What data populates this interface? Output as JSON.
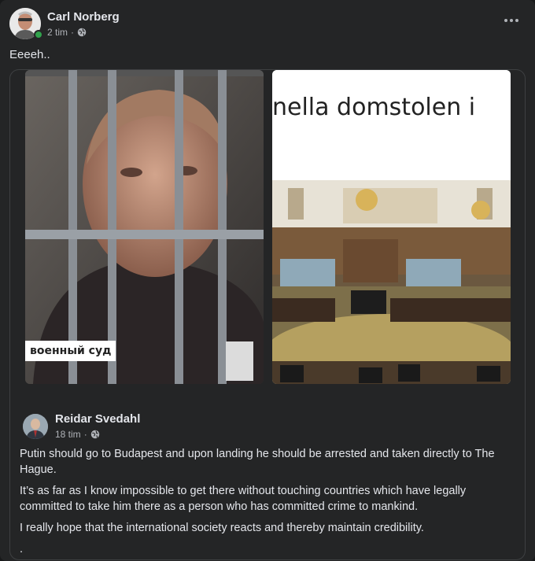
{
  "post": {
    "author": "Carl Norberg",
    "time": "2 tim",
    "separator": "·",
    "text": "Eeeeh..",
    "more_icon": "ellipsis-icon",
    "audience_icon": "globe-icon"
  },
  "shared_post": {
    "images": {
      "left_caption": "военный суд",
      "right_banner": "nella domstolen i"
    },
    "author": "Reidar Svedahl",
    "time": "18 tim",
    "separator": "·",
    "paragraphs": [
      "Putin should go to Budapest and upon landing he should be arrested and taken directly to The Hague.",
      "It’s as far as I know impossible to get there without touching countries which have legally committed to take him there as a person who has committed crime to mankind.",
      "I really hope that the international society reacts  and thereby maintain credibility.",
      "."
    ]
  },
  "colors": {
    "background": "#242526",
    "text_primary": "#e4e6eb",
    "text_secondary": "#b0b3b8",
    "online": "#31a24c"
  }
}
